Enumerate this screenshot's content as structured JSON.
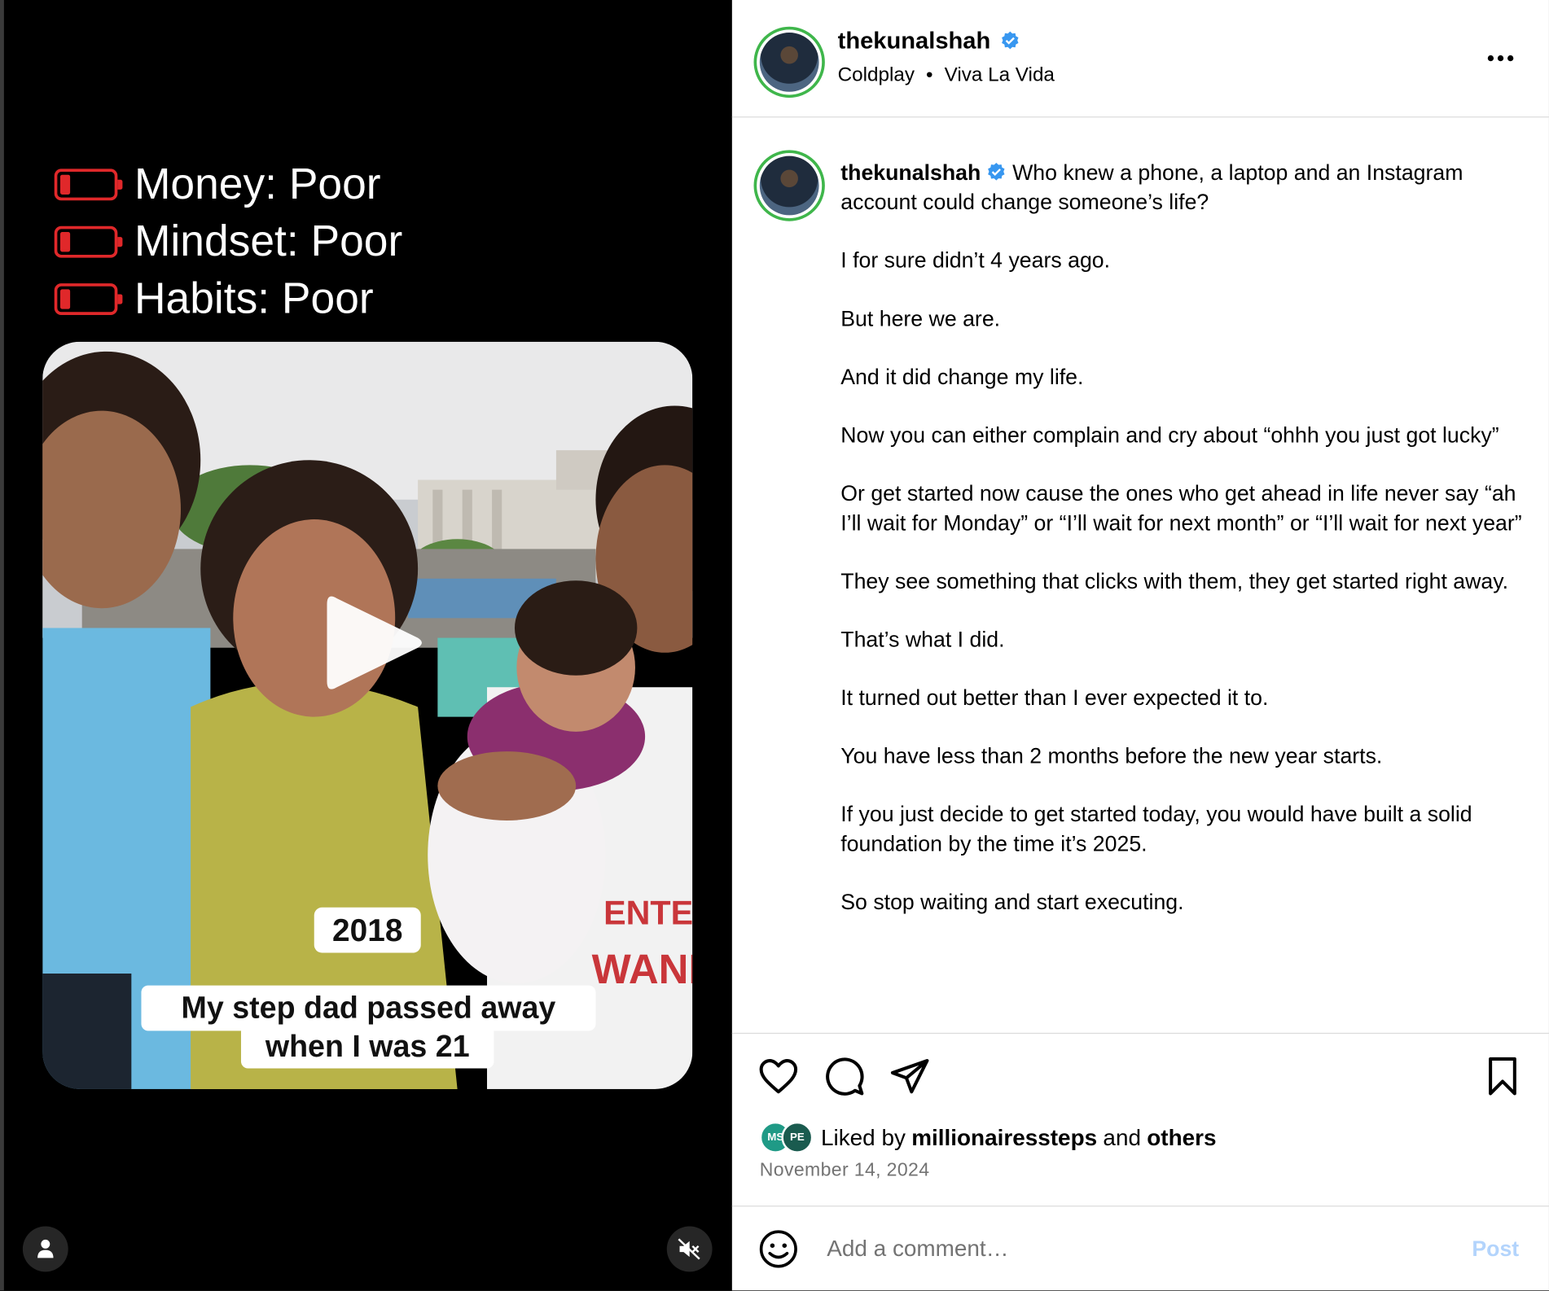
{
  "video": {
    "stats": [
      {
        "label": "Money: Poor"
      },
      {
        "label": "Mindset: Poor"
      },
      {
        "label": "Habits: Poor"
      }
    ],
    "year_badge": "2018",
    "caption_line1": "My step dad passed away",
    "caption_line2": "when I was 21",
    "photo_signage": [
      "ENTER",
      "WAND"
    ],
    "battery_color": "#e0282a"
  },
  "post": {
    "username": "thekunalshah",
    "audio_artist": "Coldplay",
    "audio_separator": "•",
    "audio_track": "Viva La Vida",
    "caption_first": "Who knew a phone, a laptop and an Instagram account could change someone’s life?",
    "caption_paragraphs": [
      "I for sure didn’t 4 years ago.",
      "But here we are.",
      "And it did change my life.",
      "Now you can either complain and cry about “ohhh you just got lucky”",
      "Or get started now cause the ones who get ahead in life never say “ah I’ll wait for Monday” or “I’ll wait for next month” or “I’ll wait for next year”",
      "They see something that clicks with them, they get started right away.",
      "That’s what I did.",
      "It turned out better than I ever expected it to.",
      "You have less than 2 months before the new year starts.",
      "If you just decide to get started today, you would have built a solid foundation by the time it’s 2025.",
      "So stop waiting and start executing."
    ],
    "liked_prefix": "Liked by",
    "liked_user": "millionairessteps",
    "liked_and": "and",
    "liked_others": "others",
    "liker_avatar_1": "MS",
    "liker_avatar_2": "PE",
    "date": "November 14, 2024",
    "comment_placeholder": "Add a comment…",
    "post_label": "Post"
  },
  "icons": {
    "verified": "verified-badge-icon",
    "more": "more-options-icon",
    "like": "heart-icon",
    "comment": "comment-icon",
    "share": "share-icon",
    "save": "bookmark-icon",
    "emoji": "emoji-icon",
    "user": "user-icon",
    "mute": "muted-speaker-icon",
    "play": "play-icon"
  },
  "colors": {
    "verified_blue": "#3897f0",
    "story_ring": "#3fb64b",
    "post_button_disabled": "#b3d4fc"
  }
}
